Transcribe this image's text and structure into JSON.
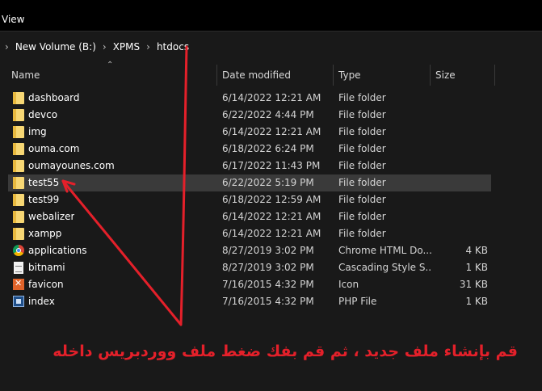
{
  "menubar": {
    "view_label": "View"
  },
  "breadcrumb": {
    "items": [
      "New Volume (B:)",
      "XPMS",
      "htdocs"
    ]
  },
  "columns": {
    "name": "Name",
    "date": "Date modified",
    "type": "Type",
    "size": "Size"
  },
  "files": [
    {
      "name": "dashboard",
      "date": "6/14/2022 12:21 AM",
      "type": "File folder",
      "size": "",
      "icon": "folder-icon"
    },
    {
      "name": "devco",
      "date": "6/22/2022 4:44 PM",
      "type": "File folder",
      "size": "",
      "icon": "folder-icon"
    },
    {
      "name": "img",
      "date": "6/14/2022 12:21 AM",
      "type": "File folder",
      "size": "",
      "icon": "folder-icon"
    },
    {
      "name": "ouma.com",
      "date": "6/18/2022 6:24 PM",
      "type": "File folder",
      "size": "",
      "icon": "folder-icon"
    },
    {
      "name": "oumayounes.com",
      "date": "6/17/2022 11:43 PM",
      "type": "File folder",
      "size": "",
      "icon": "folder-icon"
    },
    {
      "name": "test55",
      "date": "6/22/2022 5:19 PM",
      "type": "File folder",
      "size": "",
      "icon": "folder-icon"
    },
    {
      "name": "test99",
      "date": "6/18/2022 12:59 AM",
      "type": "File folder",
      "size": "",
      "icon": "folder-icon"
    },
    {
      "name": "webalizer",
      "date": "6/14/2022 12:21 AM",
      "type": "File folder",
      "size": "",
      "icon": "folder-icon"
    },
    {
      "name": "xampp",
      "date": "6/14/2022 12:21 AM",
      "type": "File folder",
      "size": "",
      "icon": "folder-icon"
    },
    {
      "name": "applications",
      "date": "8/27/2019 3:02 PM",
      "type": "Chrome HTML Do...",
      "size": "4 KB",
      "icon": "chrome-icon"
    },
    {
      "name": "bitnami",
      "date": "8/27/2019 3:02 PM",
      "type": "Cascading Style S...",
      "size": "1 KB",
      "icon": "document-icon"
    },
    {
      "name": "favicon",
      "date": "7/16/2015 4:32 PM",
      "type": "Icon",
      "size": "31 KB",
      "icon": "favicon-icon"
    },
    {
      "name": "index",
      "date": "7/16/2015 4:32 PM",
      "type": "PHP File",
      "size": "1 KB",
      "icon": "php-file-icon"
    }
  ],
  "selected_item": "test55",
  "annotation": {
    "caption": "قم بإنشاء ملف جديد ، ثم قم بفك ضغط ملف ووردبريس داخله",
    "color": "#e4202a"
  }
}
